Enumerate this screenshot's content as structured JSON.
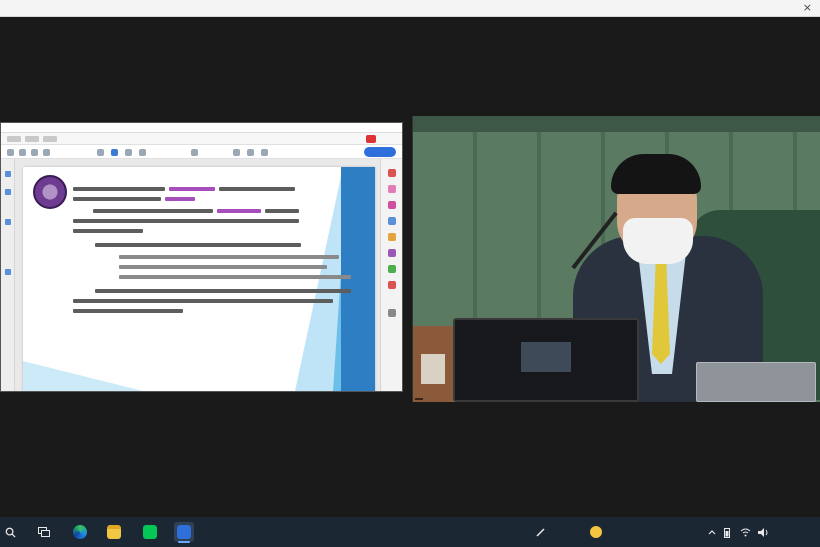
{
  "window": {
    "close_glyph": "×"
  },
  "shared_screen": {
    "doc_tab_title": "",
    "sign_button_label": "",
    "seal_icon": "organization-seal-icon"
  },
  "video": {
    "participant_name": ""
  },
  "taskbar": {
    "icons": [
      "search-icon",
      "task-view-icon",
      "edge-browser-icon",
      "file-explorer-icon",
      "line-app-icon",
      "zoom-app-icon"
    ],
    "tray_icons": [
      "pen-icon",
      "weather-icon",
      "chevron-up-icon",
      "battery-icon",
      "wifi-icon",
      "volume-icon"
    ],
    "weather_text": "",
    "language": "",
    "clock": ""
  },
  "colors": {
    "taskbar": "#1b2733",
    "slide_accent": "#2d7ec2",
    "slide_highlight": "#a44fbb",
    "zoom_blue": "#2f6fdc",
    "wall_green": "#4b6a56",
    "tie_yellow": "#e0c83a"
  }
}
